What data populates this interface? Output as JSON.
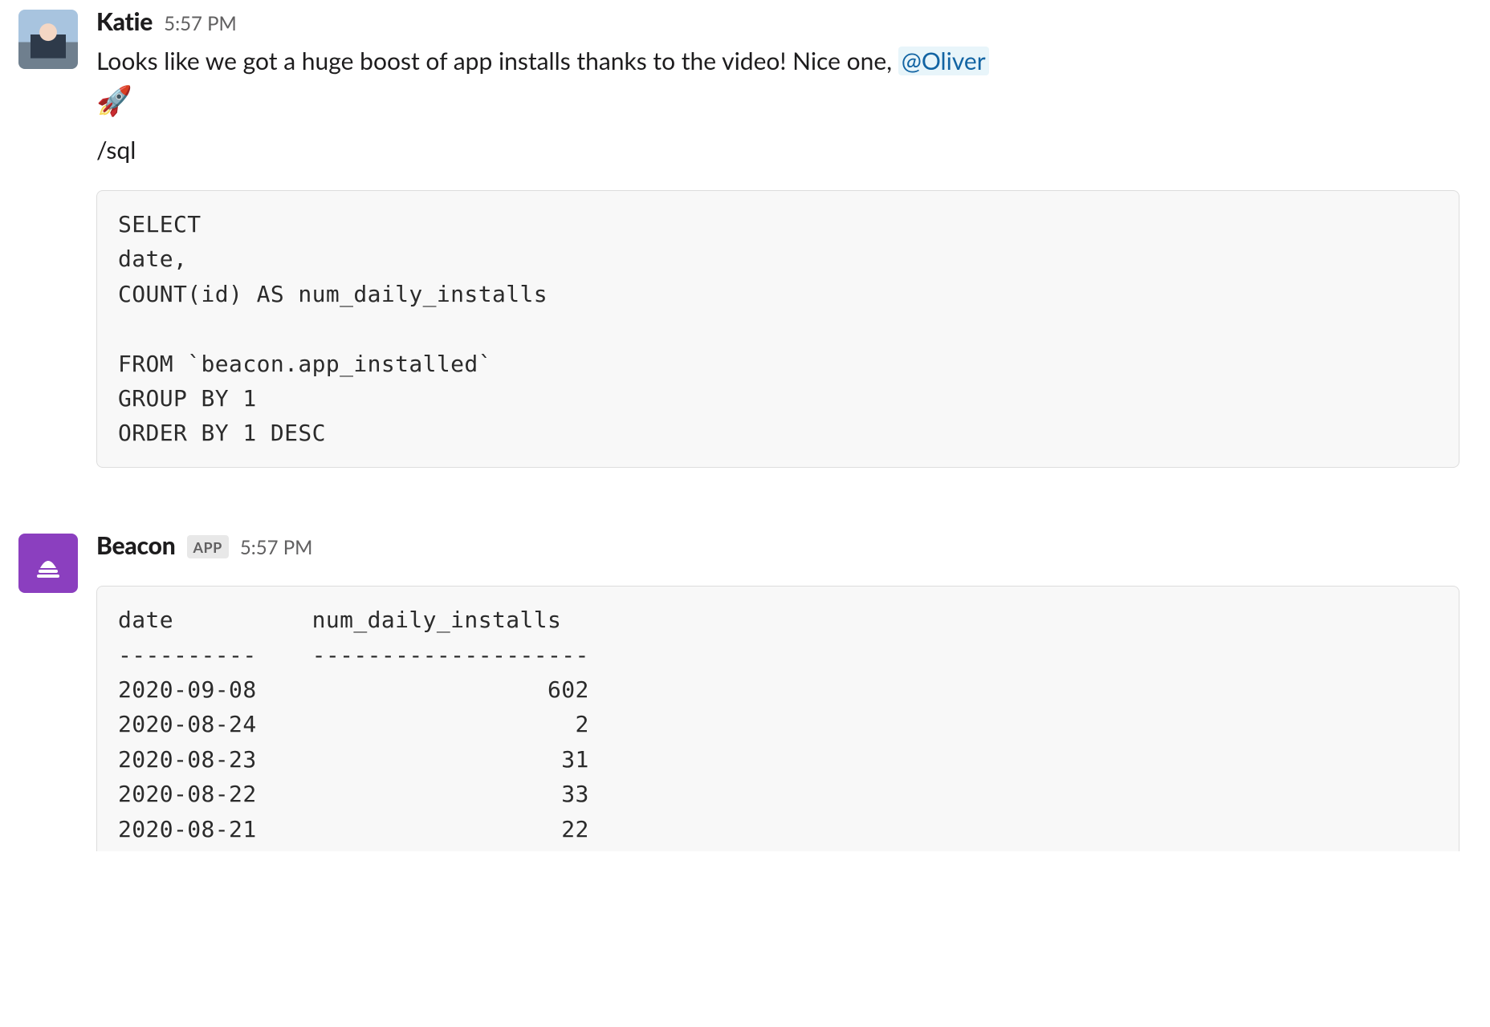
{
  "messages": [
    {
      "sender": "Katie",
      "timestamp": "5:57 PM",
      "text_before_mention": "Looks like we got a huge boost of app installs thanks to the video! Nice one, ",
      "mention": "@Oliver",
      "emoji": "🚀",
      "slash_command": "/sql",
      "code": "SELECT\ndate,\nCOUNT(id) AS num_daily_installs\n\nFROM `beacon.app_installed`\nGROUP BY 1\nORDER BY 1 DESC"
    },
    {
      "sender": "Beacon",
      "app_badge": "APP",
      "timestamp": "5:57 PM",
      "result_table": {
        "columns": [
          "date",
          "num_daily_installs"
        ],
        "rows": [
          [
            "2020-09-08",
            602
          ],
          [
            "2020-08-24",
            2
          ],
          [
            "2020-08-23",
            31
          ],
          [
            "2020-08-22",
            33
          ],
          [
            "2020-08-21",
            22
          ]
        ]
      }
    }
  ]
}
